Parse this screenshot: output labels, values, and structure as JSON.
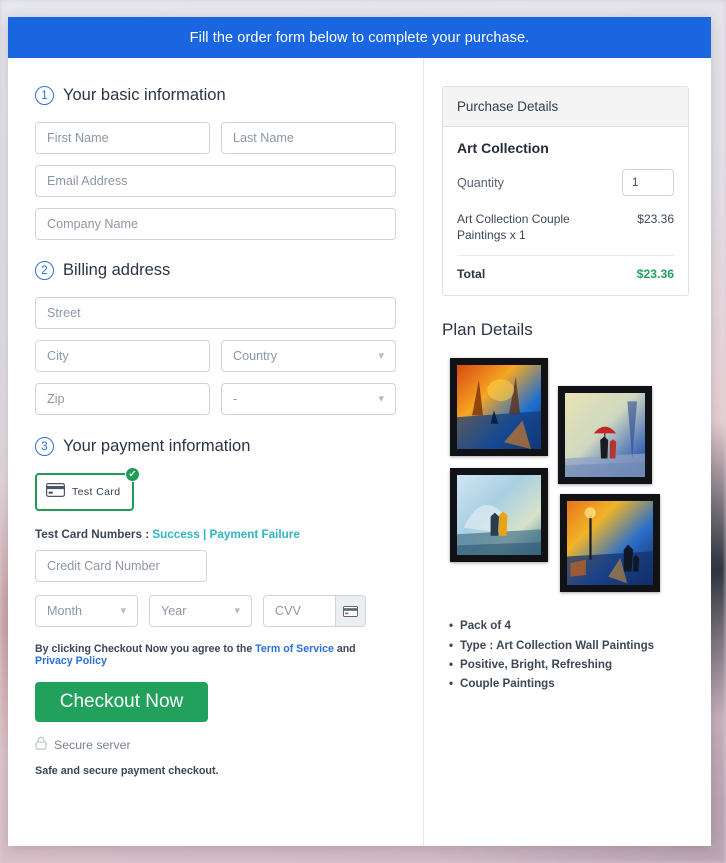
{
  "banner": {
    "text": "Fill the order form below to complete your purchase."
  },
  "sections": {
    "basic": {
      "number": "1",
      "title": "Your basic information"
    },
    "billing": {
      "number": "2",
      "title": "Billing address"
    },
    "payment": {
      "number": "3",
      "title": "Your payment information"
    }
  },
  "fields": {
    "first_name": "First Name",
    "last_name": "Last Name",
    "email": "Email Address",
    "company": "Company Name",
    "street": "Street",
    "city": "City",
    "country": "Country",
    "zip": "Zip",
    "state": "-",
    "credit_card": "Credit Card Number",
    "month": "Month",
    "year": "Year",
    "cvv": "CVV"
  },
  "payment": {
    "test_card_label": "Test Card",
    "test_card_icon": "credit-card-icon",
    "selected_check": "✔",
    "test_numbers_prefix": "Test Card Numbers : ",
    "success_link": "Success",
    "separator": " | ",
    "failure_link": "Payment Failure",
    "link_color": "#30b5c4"
  },
  "terms": {
    "prefix": "By clicking Checkout Now you agree to the ",
    "tos_link": "Term of Service",
    "conjunction": " and ",
    "privacy_link": "Privacy Policy",
    "link_color": "#2a6fdb"
  },
  "checkout": {
    "button_label": "Checkout Now",
    "button_color": "#22a15d",
    "secure_label": "Secure server",
    "lock_icon": "lock-icon",
    "safe_note": "Safe and secure payment checkout."
  },
  "purchase": {
    "header": "Purchase Details",
    "product_name": "Art Collection",
    "quantity_label": "Quantity",
    "quantity_value": "1",
    "line_item_name": "Art Collection Couple Paintings x 1",
    "line_item_price": "$23.36",
    "total_label": "Total",
    "total_value": "$23.36",
    "total_color": "#22a15d"
  },
  "plan": {
    "title": "Plan Details",
    "images": [
      {
        "name": "autumn-forest-couple-painting"
      },
      {
        "name": "red-umbrella-rain-painting"
      },
      {
        "name": "winter-walk-couple-painting"
      },
      {
        "name": "night-street-lamp-couple-painting"
      }
    ],
    "bullets": [
      "Pack of 4",
      "Type : Art Collection Wall Paintings",
      "Positive, Bright, Refreshing",
      "Couple Paintings"
    ]
  },
  "colors": {
    "banner_blue": "#1a66e0",
    "step_blue": "#2a6fdb",
    "accent_green": "#22a15d",
    "test_card_green": "#1f9d55"
  }
}
